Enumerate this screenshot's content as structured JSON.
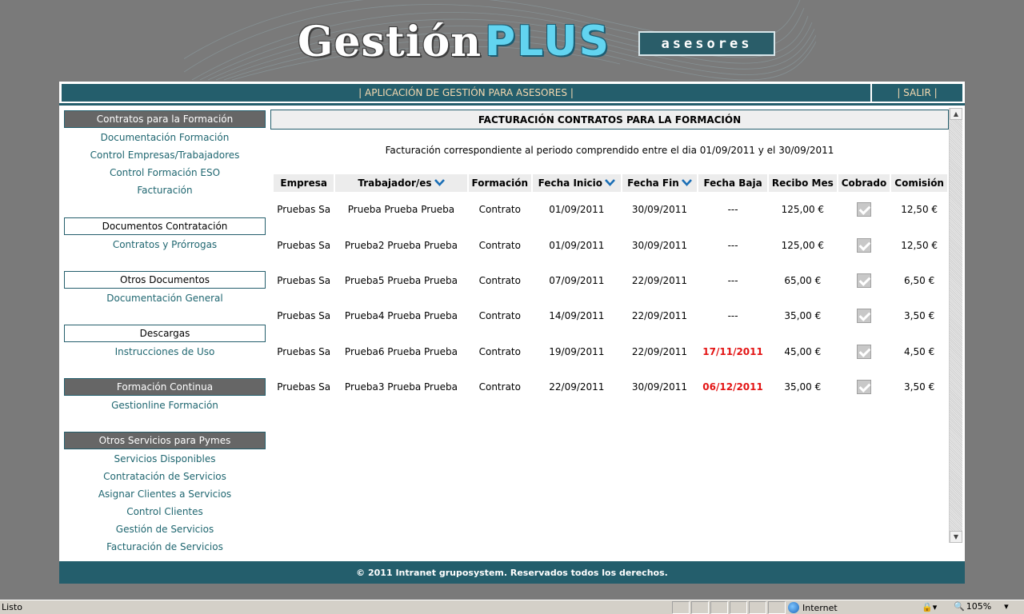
{
  "logo": {
    "gestion": "Gestión",
    "plus": "PLUS",
    "badge": "asesores"
  },
  "topbar": {
    "title": "| APLICACIÓN DE GESTIÓN PARA ASESORES |",
    "exit": "| SALIR |"
  },
  "sidebar": {
    "sections": [
      {
        "title": "Contratos para la Formación",
        "style": "dark",
        "links": [
          "Documentación Formación",
          "Control Empresas/Trabajadores",
          "Control Formación ESO",
          "Facturación"
        ]
      },
      {
        "title": "Documentos Contratación",
        "style": "light",
        "links": [
          "Contratos y Prórrogas"
        ]
      },
      {
        "title": "Otros Documentos",
        "style": "light",
        "links": [
          "Documentación General"
        ]
      },
      {
        "title": "Descargas",
        "style": "light",
        "links": [
          "Instrucciones de Uso"
        ]
      },
      {
        "title": "Formación Continua",
        "style": "dark",
        "links": [
          "Gestionline Formación"
        ]
      },
      {
        "title": "Otros Servicios para Pymes",
        "style": "dark",
        "links": [
          "Servicios Disponibles",
          "Contratación de Servicios",
          "Asignar Clientes a Servicios",
          "Control Clientes",
          "Gestión de Servicios",
          "Facturación de Servicios"
        ]
      }
    ]
  },
  "content": {
    "title": "FACTURACIÓN CONTRATOS PARA LA FORMACIÓN",
    "period": "Facturación correspondiente al periodo comprendido entre el dia 01/09/2011 y el 30/09/2011",
    "columns": [
      {
        "label": "Empresa",
        "sortable": false
      },
      {
        "label": "Trabajador/es",
        "sortable": true
      },
      {
        "label": "Formación",
        "sortable": false
      },
      {
        "label": "Fecha Inicio",
        "sortable": true
      },
      {
        "label": "Fecha Fin",
        "sortable": true
      },
      {
        "label": "Fecha Baja",
        "sortable": false
      },
      {
        "label": "Recibo Mes",
        "sortable": false
      },
      {
        "label": "Cobrado",
        "sortable": false
      },
      {
        "label": "Comisión",
        "sortable": false
      }
    ],
    "rows": [
      {
        "empresa": "Pruebas Sa",
        "trabajador": "Prueba Prueba Prueba",
        "formacion": "Contrato",
        "inicio": "01/09/2011",
        "fin": "30/09/2011",
        "baja": "---",
        "baja_alert": false,
        "recibo": "125,00 €",
        "cobrado": true,
        "comision": "12,50 €"
      },
      {
        "empresa": "Pruebas Sa",
        "trabajador": "Prueba2 Prueba Prueba",
        "formacion": "Contrato",
        "inicio": "01/09/2011",
        "fin": "30/09/2011",
        "baja": "---",
        "baja_alert": false,
        "recibo": "125,00 €",
        "cobrado": true,
        "comision": "12,50 €"
      },
      {
        "empresa": "Pruebas Sa",
        "trabajador": "Prueba5 Prueba Prueba",
        "formacion": "Contrato",
        "inicio": "07/09/2011",
        "fin": "22/09/2011",
        "baja": "---",
        "baja_alert": false,
        "recibo": "65,00 €",
        "cobrado": true,
        "comision": "6,50 €"
      },
      {
        "empresa": "Pruebas Sa",
        "trabajador": "Prueba4 Prueba Prueba",
        "formacion": "Contrato",
        "inicio": "14/09/2011",
        "fin": "22/09/2011",
        "baja": "---",
        "baja_alert": false,
        "recibo": "35,00 €",
        "cobrado": true,
        "comision": "3,50 €"
      },
      {
        "empresa": "Pruebas Sa",
        "trabajador": "Prueba6 Prueba Prueba",
        "formacion": "Contrato",
        "inicio": "19/09/2011",
        "fin": "22/09/2011",
        "baja": "17/11/2011",
        "baja_alert": true,
        "recibo": "45,00 €",
        "cobrado": true,
        "comision": "4,50 €"
      },
      {
        "empresa": "Pruebas Sa",
        "trabajador": "Prueba3 Prueba Prueba",
        "formacion": "Contrato",
        "inicio": "22/09/2011",
        "fin": "30/09/2011",
        "baja": "06/12/2011",
        "baja_alert": true,
        "recibo": "35,00 €",
        "cobrado": true,
        "comision": "3,50 €"
      }
    ]
  },
  "footer": {
    "text": "© 2011 Intranet gruposystem. Reservados todos los derechos."
  },
  "statusbar": {
    "status": "Listo",
    "zone": "Internet",
    "zoom": "105%"
  },
  "colors": {
    "teal": "#245e6c",
    "alert": "#e31414",
    "sort_icon": "#1b6fb6",
    "link": "#1f6670"
  }
}
